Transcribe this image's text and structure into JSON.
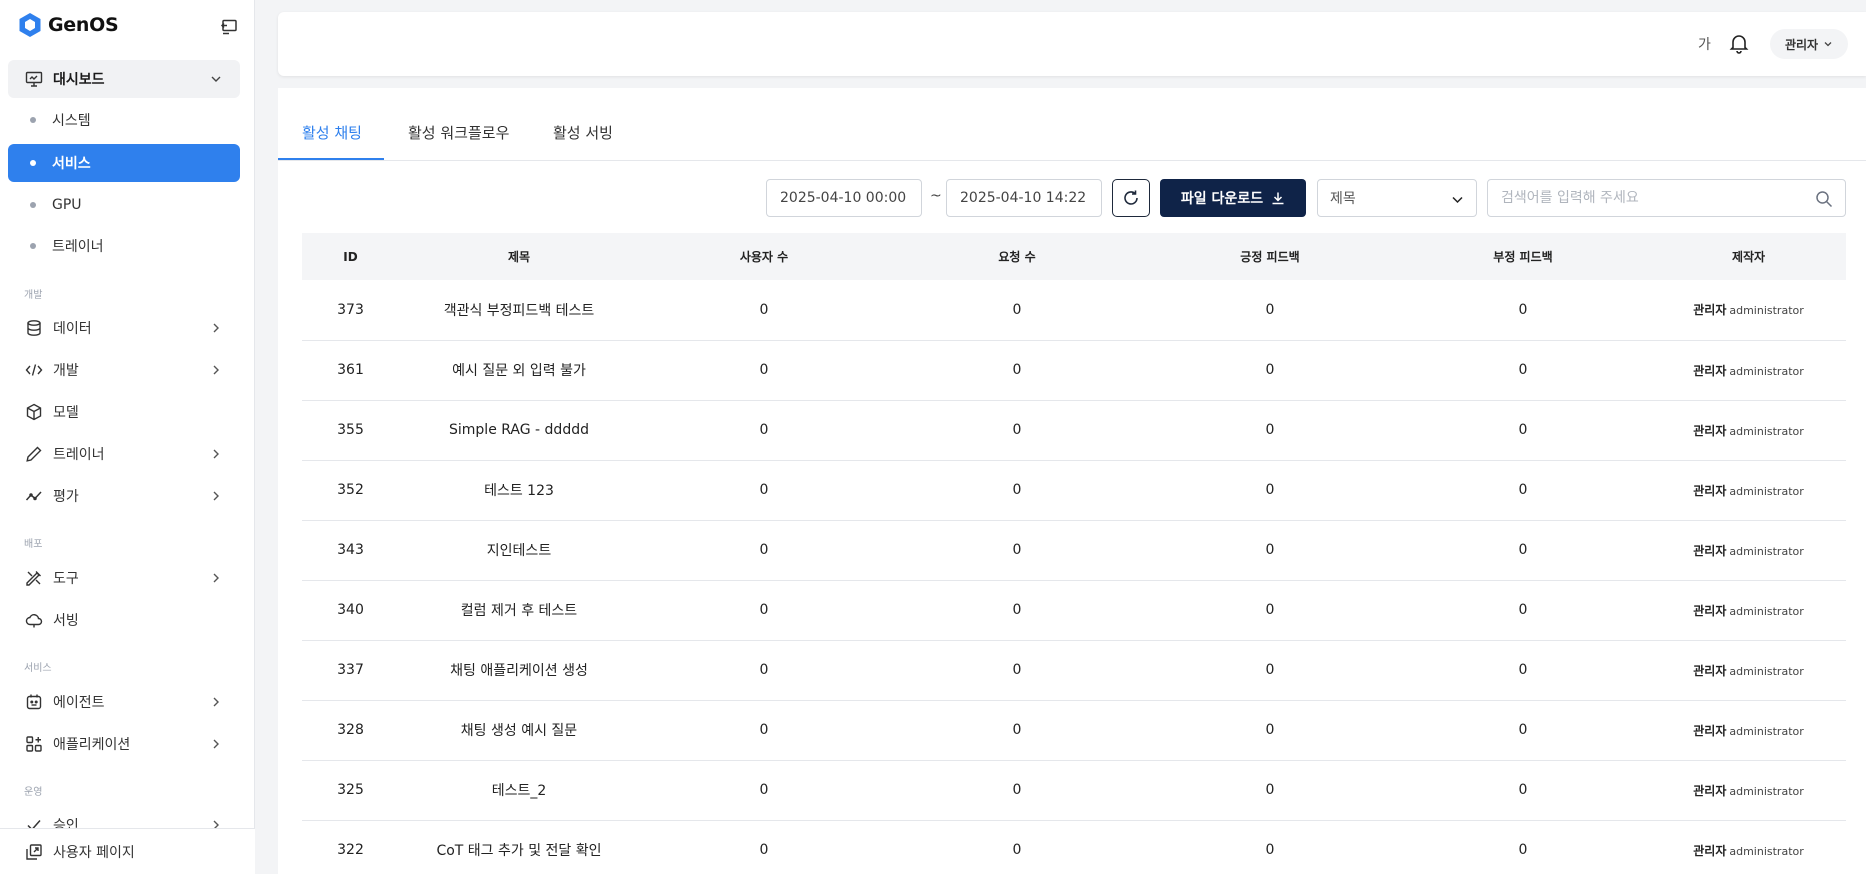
{
  "app": {
    "name": "GenOS"
  },
  "sidebar": {
    "dashboard": {
      "label": "대시보드",
      "children": [
        "시스템",
        "서비스",
        "GPU",
        "트레이너"
      ],
      "active_child": "서비스"
    },
    "sections": [
      {
        "label": "개발",
        "items": [
          {
            "label": "데이터",
            "icon": "database-icon",
            "has_children": true
          },
          {
            "label": "개발",
            "icon": "code-icon",
            "has_children": true
          },
          {
            "label": "모델",
            "icon": "cube-icon",
            "has_children": false
          },
          {
            "label": "트레이너",
            "icon": "pencil-icon",
            "has_children": true
          },
          {
            "label": "평가",
            "icon": "trend-icon",
            "has_children": true
          }
        ]
      },
      {
        "label": "배포",
        "items": [
          {
            "label": "도구",
            "icon": "tools-icon",
            "has_children": true
          },
          {
            "label": "서빙",
            "icon": "cloud-icon",
            "has_children": false
          }
        ]
      },
      {
        "label": "서비스",
        "items": [
          {
            "label": "에이전트",
            "icon": "agent-icon",
            "has_children": true
          },
          {
            "label": "애플리케이션",
            "icon": "apps-icon",
            "has_children": true
          }
        ]
      },
      {
        "label": "운영",
        "items": [
          {
            "label": "승인",
            "icon": "check-icon",
            "has_children": true
          }
        ]
      }
    ],
    "footer": {
      "label": "사용자 페이지",
      "icon": "user-page-icon"
    }
  },
  "header": {
    "font_toggle": "가",
    "user_label": "관리자"
  },
  "tabs": [
    {
      "label": "활성 채팅",
      "active": true
    },
    {
      "label": "활성 워크플로우",
      "active": false
    },
    {
      "label": "활성 서빙",
      "active": false
    }
  ],
  "filters": {
    "date_from": "2025-04-10 00:00",
    "separator": "~",
    "date_to": "2025-04-10 14:22",
    "download_label": "파일 다운로드",
    "select_value": "제목",
    "search_placeholder": "검색어를 입력해 주세요"
  },
  "table": {
    "columns": [
      "ID",
      "제목",
      "사용자 수",
      "요청 수",
      "긍정 피드백",
      "부정 피드백",
      "제작자"
    ],
    "rows": [
      {
        "id": "373",
        "title": "객관식 부정피드백 테스트",
        "users": "0",
        "requests": "0",
        "positive": "0",
        "negative": "0",
        "author_name": "관리자",
        "author_id": "administrator"
      },
      {
        "id": "361",
        "title": "예시 질문 외 입력 불가",
        "users": "0",
        "requests": "0",
        "positive": "0",
        "negative": "0",
        "author_name": "관리자",
        "author_id": "administrator"
      },
      {
        "id": "355",
        "title": "Simple RAG - ddddd",
        "users": "0",
        "requests": "0",
        "positive": "0",
        "negative": "0",
        "author_name": "관리자",
        "author_id": "administrator"
      },
      {
        "id": "352",
        "title": "테스트 123",
        "users": "0",
        "requests": "0",
        "positive": "0",
        "negative": "0",
        "author_name": "관리자",
        "author_id": "administrator"
      },
      {
        "id": "343",
        "title": "지인테스트",
        "users": "0",
        "requests": "0",
        "positive": "0",
        "negative": "0",
        "author_name": "관리자",
        "author_id": "administrator"
      },
      {
        "id": "340",
        "title": "컬럼 제거 후 테스트",
        "users": "0",
        "requests": "0",
        "positive": "0",
        "negative": "0",
        "author_name": "관리자",
        "author_id": "administrator"
      },
      {
        "id": "337",
        "title": "채팅 애플리케이션 생성",
        "users": "0",
        "requests": "0",
        "positive": "0",
        "negative": "0",
        "author_name": "관리자",
        "author_id": "administrator"
      },
      {
        "id": "328",
        "title": "채팅 생성 예시 질문",
        "users": "0",
        "requests": "0",
        "positive": "0",
        "negative": "0",
        "author_name": "관리자",
        "author_id": "administrator"
      },
      {
        "id": "325",
        "title": "테스트_2",
        "users": "0",
        "requests": "0",
        "positive": "0",
        "negative": "0",
        "author_name": "관리자",
        "author_id": "administrator"
      },
      {
        "id": "322",
        "title": "CoT 태그 추가 및 전달 확인",
        "users": "0",
        "requests": "0",
        "positive": "0",
        "negative": "0",
        "author_name": "관리자",
        "author_id": "administrator"
      }
    ]
  },
  "colors": {
    "accent": "#2f80ed",
    "primary_dark": "#0f2348",
    "muted": "#9ca3af"
  }
}
